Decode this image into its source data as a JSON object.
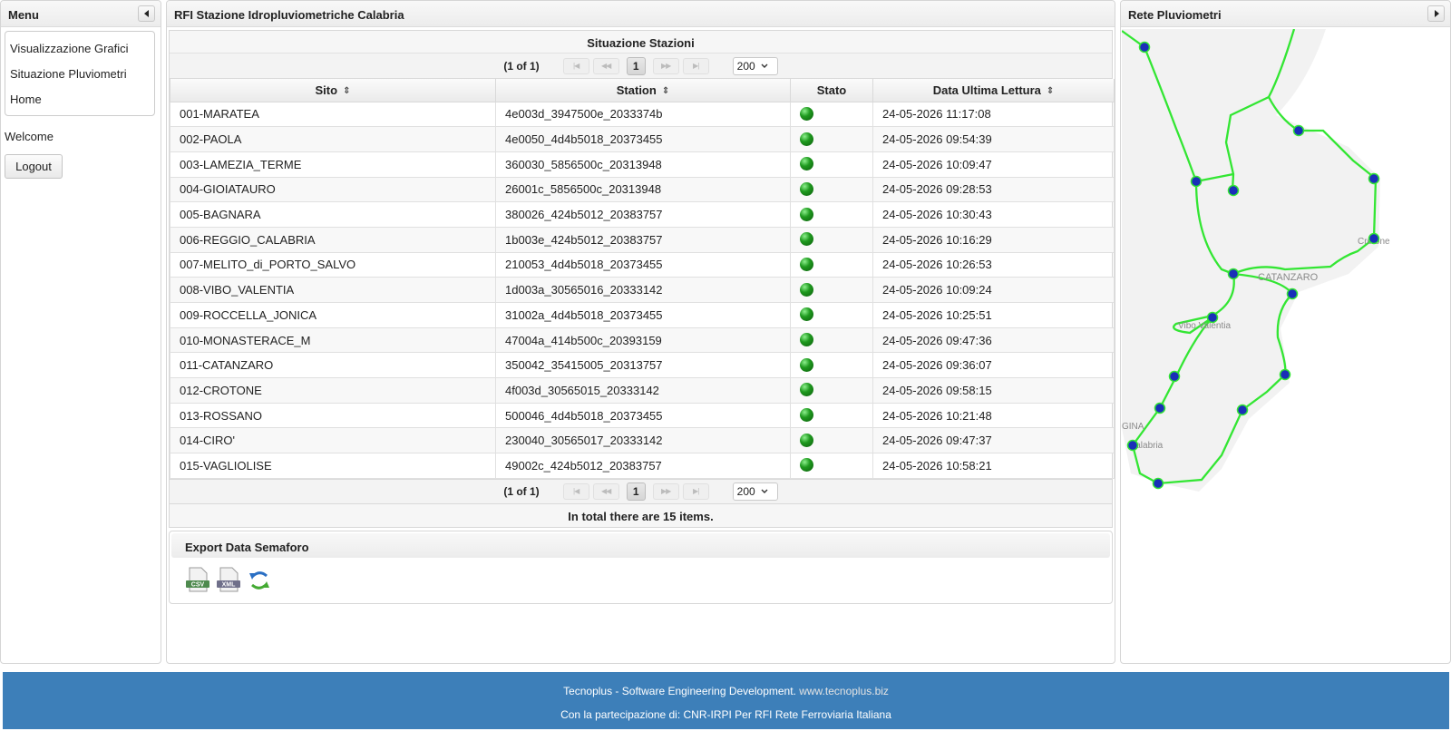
{
  "menu": {
    "title": "Menu",
    "items": [
      {
        "label": "Visualizzazione Grafici"
      },
      {
        "label": "Situazione Pluviometri"
      },
      {
        "label": "Home"
      }
    ],
    "welcome": "Welcome",
    "logout_label": "Logout"
  },
  "center": {
    "title": "RFI Stazione Idropluviometriche Calabria",
    "grid_caption": "Situazione Stazioni",
    "paginator": {
      "report": "(1 of 1)",
      "first": "|◀",
      "prev": "◀◀",
      "current_page": "1",
      "next": "▶▶",
      "last": "▶|",
      "rows_per_page": "200"
    },
    "columns": [
      "Sito",
      "Station",
      "Stato",
      "Data Ultima Lettura"
    ],
    "rows": [
      {
        "sito": "001-MARATEA",
        "station": "4e003d_3947500e_2033374b",
        "data": "24-05-2026 11:17:08"
      },
      {
        "sito": "002-PAOLA",
        "station": "4e0050_4d4b5018_20373455",
        "data": "24-05-2026 09:54:39"
      },
      {
        "sito": "003-LAMEZIA_TERME",
        "station": "360030_5856500c_20313948",
        "data": "24-05-2026 10:09:47"
      },
      {
        "sito": "004-GIOIATAURO",
        "station": "26001c_5856500c_20313948",
        "data": "24-05-2026 09:28:53"
      },
      {
        "sito": "005-BAGNARA",
        "station": "380026_424b5012_20383757",
        "data": "24-05-2026 10:30:43"
      },
      {
        "sito": "006-REGGIO_CALABRIA",
        "station": "1b003e_424b5012_20383757",
        "data": "24-05-2026 10:16:29"
      },
      {
        "sito": "007-MELITO_di_PORTO_SALVO",
        "station": "210053_4d4b5018_20373455",
        "data": "24-05-2026 10:26:53"
      },
      {
        "sito": "008-VIBO_VALENTIA",
        "station": "1d003a_30565016_20333142",
        "data": "24-05-2026 10:09:24"
      },
      {
        "sito": "009-ROCCELLA_JONICA",
        "station": "31002a_4d4b5018_20373455",
        "data": "24-05-2026 10:25:51"
      },
      {
        "sito": "010-MONASTERACE_M",
        "station": "47004a_414b500c_20393159",
        "data": "24-05-2026 09:47:36"
      },
      {
        "sito": "011-CATANZARO",
        "station": "350042_35415005_20313757",
        "data": "24-05-2026 09:36:07"
      },
      {
        "sito": "012-CROTONE",
        "station": "4f003d_30565015_20333142",
        "data": "24-05-2026 09:58:15"
      },
      {
        "sito": "013-ROSSANO",
        "station": "500046_4d4b5018_20373455",
        "data": "24-05-2026 10:21:48"
      },
      {
        "sito": "014-CIRO'",
        "station": "230040_30565017_20333142",
        "data": "24-05-2026 09:47:37"
      },
      {
        "sito": "015-VAGLIOLISE",
        "station": "49002c_424b5012_20383757",
        "data": "24-05-2026 10:58:21"
      }
    ],
    "status_color": "#1f9a1f",
    "total_text": "In total there are 15 items.",
    "export": {
      "title": "Export Data Semaforo",
      "icons": [
        {
          "name": "csv-export-icon",
          "label": "CSV"
        },
        {
          "name": "xml-export-icon",
          "label": "XML"
        },
        {
          "name": "refresh-icon",
          "label": ""
        }
      ]
    }
  },
  "map": {
    "title": "Rete Pluviometri",
    "place_labels": [
      "Crotone",
      "CATANZARO",
      "Vibo Valentia",
      "GINA",
      "Calabria"
    ],
    "line_color": "#33e633",
    "station_color": "#1a2fb8"
  },
  "footer": {
    "line1": "Tecnoplus - Software Engineering Development.",
    "link": "www.tecnoplus.biz",
    "line2": "Con la partecipazione di: CNR-IRPI Per RFI Rete Ferroviaria Italiana",
    "background": "#3d7fb9"
  }
}
